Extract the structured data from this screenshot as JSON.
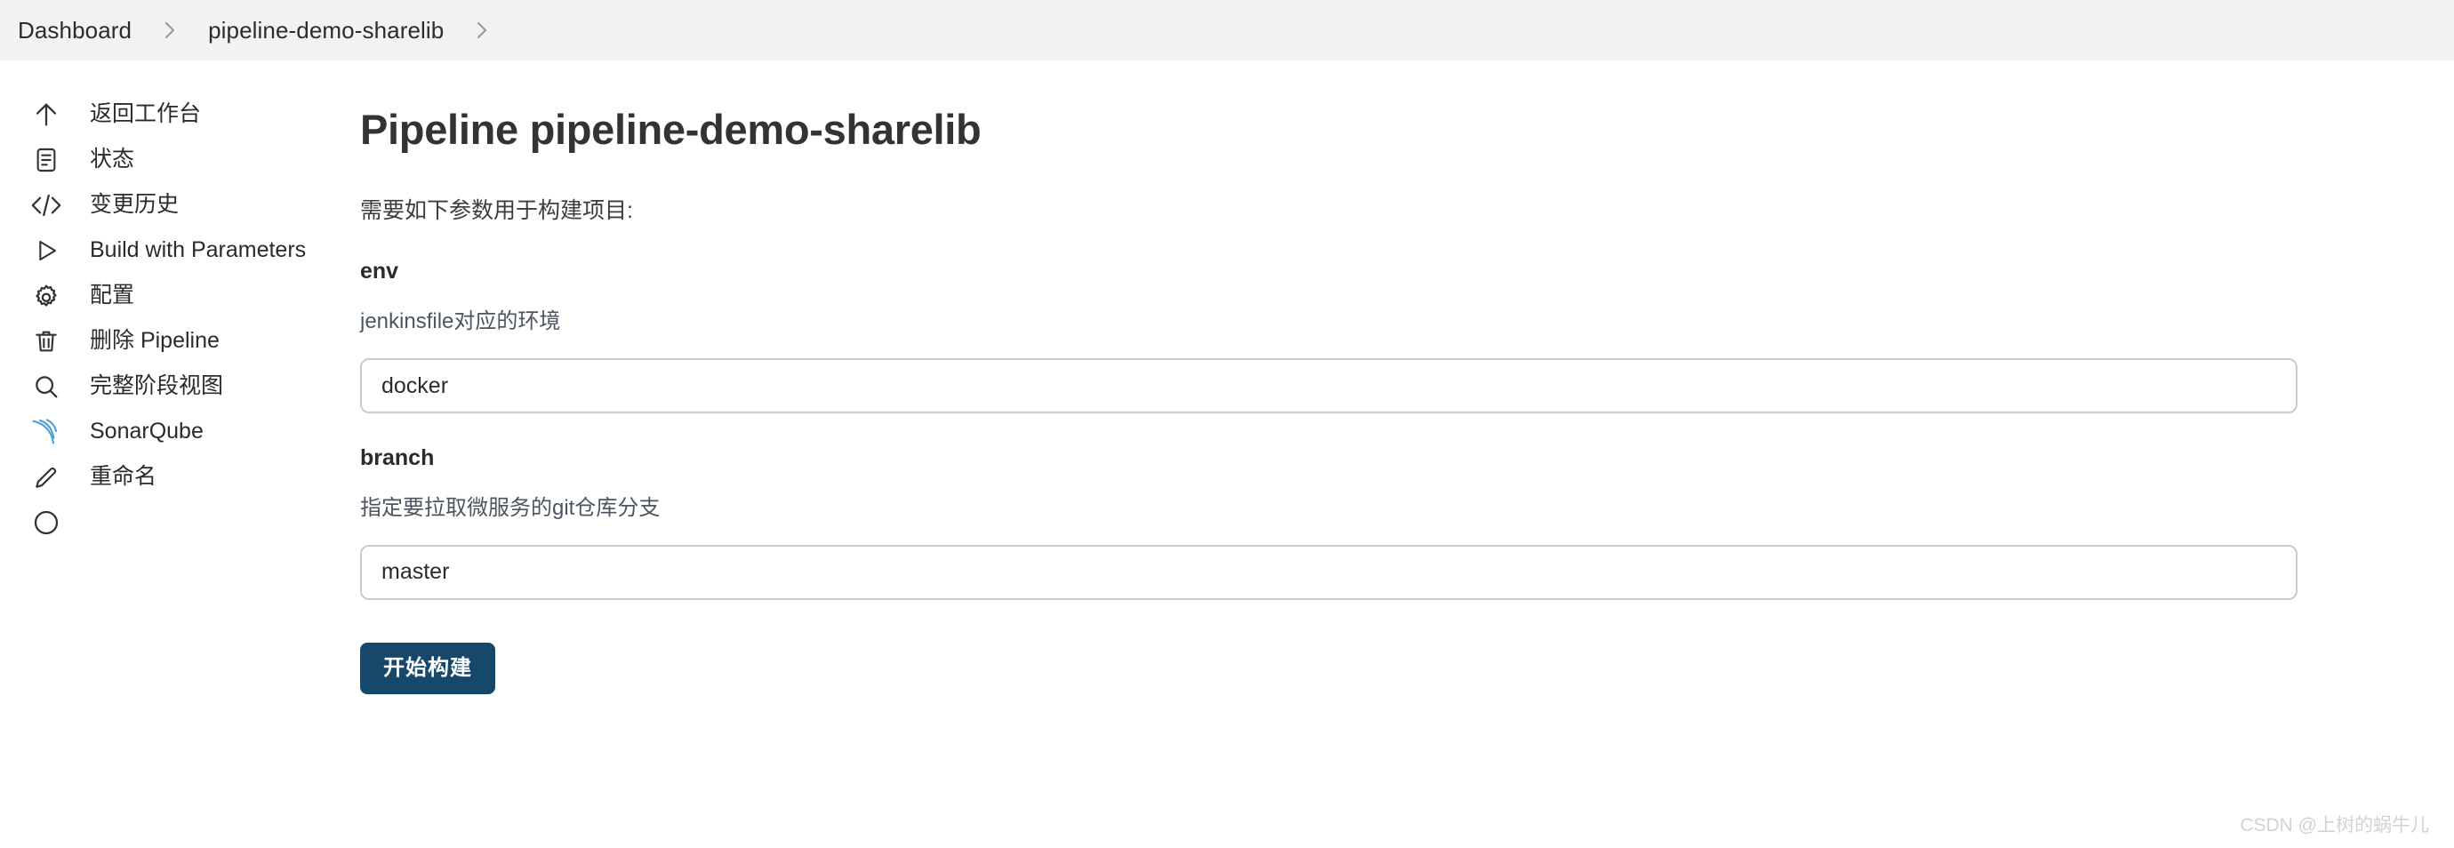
{
  "breadcrumb": {
    "items": [
      {
        "label": "Dashboard"
      },
      {
        "label": "pipeline-demo-sharelib"
      }
    ],
    "separator": "chevron-right-icon"
  },
  "sidebar": {
    "items": [
      {
        "label": "返回工作台",
        "icon": "arrow-up-icon"
      },
      {
        "label": "状态",
        "icon": "document-icon"
      },
      {
        "label": "变更历史",
        "icon": "code-brackets-icon"
      },
      {
        "label": "Build with Parameters",
        "icon": "play-triangle-icon"
      },
      {
        "label": "配置",
        "icon": "gear-icon"
      },
      {
        "label": "删除 Pipeline",
        "icon": "trash-icon"
      },
      {
        "label": "完整阶段视图",
        "icon": "search-icon"
      },
      {
        "label": "SonarQube",
        "icon": "sonarqube-icon"
      },
      {
        "label": "重命名",
        "icon": "pencil-icon"
      },
      {
        "label": "",
        "icon": "circle-icon"
      }
    ]
  },
  "main": {
    "title": "Pipeline pipeline-demo-sharelib",
    "intro": "需要如下参数用于构建项目:",
    "parameters": [
      {
        "name": "env",
        "description": "jenkinsfile对应的环境",
        "value": "docker",
        "placeholder": ""
      },
      {
        "name": "branch",
        "description": "指定要拉取微服务的git仓库分支",
        "value": "master",
        "placeholder": ""
      }
    ],
    "build_button_label": "开始构建"
  },
  "watermark": {
    "text": "CSDN @上树的蜗牛儿"
  },
  "colors": {
    "header_bg": "#f2f2f2",
    "page_bg": "#ffffff",
    "text": "#2b2b2b",
    "muted_text": "#4c5560",
    "input_border": "#c3ced4",
    "button_bg": "#15486b",
    "button_text": "#ffffff",
    "sonarqube_blue": "#4b9fd5",
    "watermark": "#d2d2d2"
  }
}
